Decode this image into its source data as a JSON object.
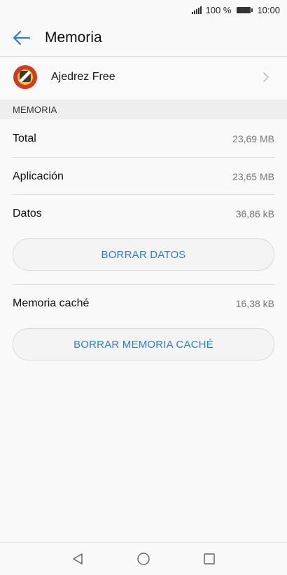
{
  "status_bar": {
    "battery": "100 %",
    "time": "10:00"
  },
  "app_bar": {
    "title": "Memoria"
  },
  "app_row": {
    "name": "Ajedrez Free"
  },
  "section": {
    "header": "MEMORIA"
  },
  "rows": [
    {
      "label": "Total",
      "value": "23,69 MB"
    },
    {
      "label": "Aplicación",
      "value": "23,65 MB"
    },
    {
      "label": "Datos",
      "value": "36,86 kB"
    }
  ],
  "clear_data_button": "BORRAR DATOS",
  "cache_row": {
    "label": "Memoria caché",
    "value": "16,38 kB"
  },
  "clear_cache_button": "BORRAR MEMORIA CACHÉ",
  "colors": {
    "accent": "#2a7fd4",
    "background": "#f9f9f9",
    "section_bg": "#eeeeee"
  },
  "icons": [
    "signal-icon",
    "battery-icon",
    "back-arrow-icon",
    "chess-app-icon",
    "chevron-right-icon",
    "nav-back-icon",
    "nav-home-icon",
    "nav-recents-icon"
  ]
}
